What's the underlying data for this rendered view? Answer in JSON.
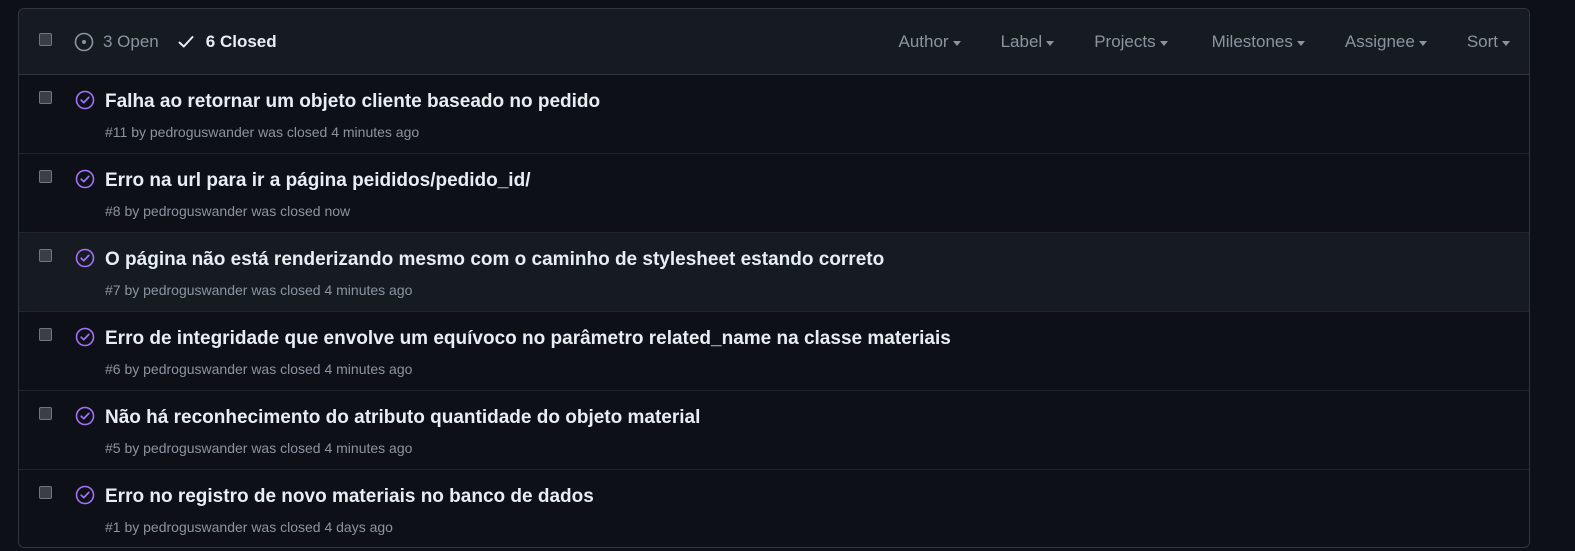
{
  "states": {
    "open_label": "3 Open",
    "closed_label": "6 Closed"
  },
  "filters": {
    "author": "Author",
    "label": "Label",
    "projects": "Projects",
    "milestones": "Milestones",
    "assignee": "Assignee",
    "sort": "Sort"
  },
  "colors": {
    "closed_icon": "#a371f7",
    "background": "#0d1117",
    "header_bg": "#161b22"
  },
  "issues": [
    {
      "title": "Falha ao retornar um objeto cliente baseado no pedido",
      "meta": "#11 by pedroguswander was closed 4 minutes ago"
    },
    {
      "title": "Erro na url para ir a página peididos/pedido_id/",
      "meta": "#8 by pedroguswander was closed now"
    },
    {
      "title": "O página não está renderizando mesmo com o caminho de stylesheet estando correto",
      "meta": "#7 by pedroguswander was closed 4 minutes ago"
    },
    {
      "title": "Erro de integridade que envolve um equívoco no parâmetro related_name na classe materiais",
      "meta": "#6 by pedroguswander was closed 4 minutes ago"
    },
    {
      "title": "Não há reconhecimento do atributo quantidade do objeto material",
      "meta": "#5 by pedroguswander was closed 4 minutes ago"
    },
    {
      "title": "Erro no registro de novo materiais no banco de dados",
      "meta": "#1 by pedroguswander was closed 4 days ago"
    }
  ]
}
